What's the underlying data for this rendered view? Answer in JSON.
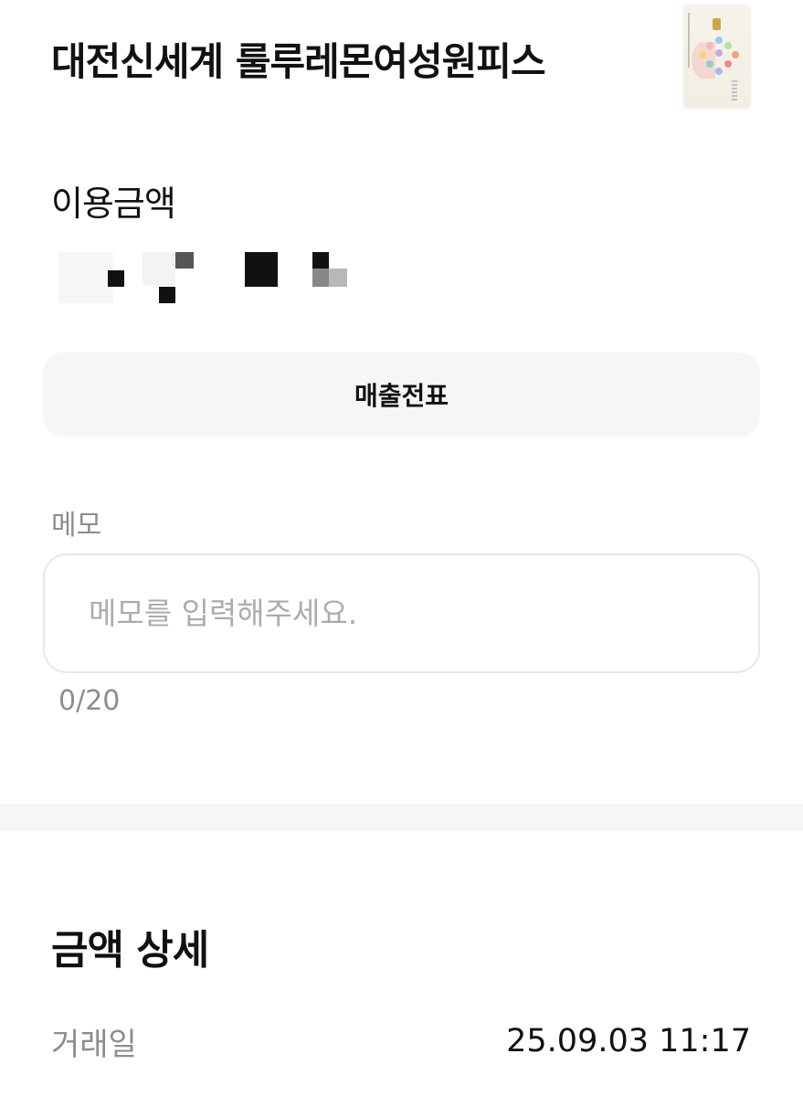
{
  "header": {
    "merchant_name": "대전신세계 룰루레몬여성원피스"
  },
  "amount": {
    "label": "이용금액",
    "value_state": "pixelated"
  },
  "actions": {
    "receipt_button_label": "매출전표"
  },
  "memo": {
    "label": "메모",
    "placeholder": "메모를 입력해주세요.",
    "value": "",
    "counter": "0/20"
  },
  "details": {
    "title": "금액 상세",
    "rows": [
      {
        "label": "거래일",
        "value": "25.09.03 11:17"
      }
    ]
  },
  "colors": {
    "text_primary": "#111111",
    "text_secondary": "#8a8d93",
    "button_bg": "#f5f6f8",
    "input_border": "#e6e7ea",
    "divider": "#f5f6f8"
  },
  "icons": {
    "card_thumbnail": "credit-card-image"
  }
}
